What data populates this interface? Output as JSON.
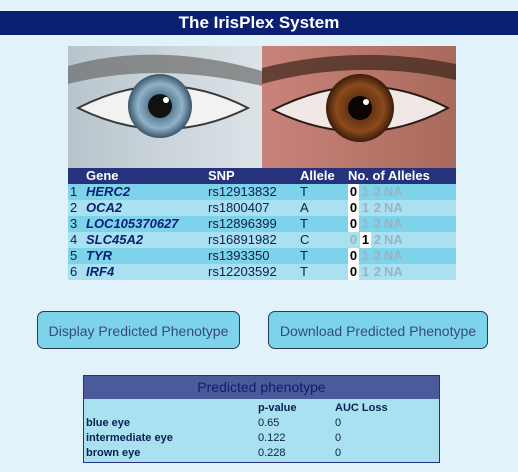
{
  "title": "The IrisPlex System",
  "table": {
    "headers": [
      "Gene",
      "SNP",
      "Allele",
      "No. of Alleles"
    ],
    "allele_options": [
      "0",
      "1",
      "2",
      "NA"
    ],
    "rows": [
      {
        "index": "1",
        "gene": "HERC2",
        "snp": "rs12913832",
        "allele": "T",
        "selected": "0"
      },
      {
        "index": "2",
        "gene": "OCA2",
        "snp": "rs1800407",
        "allele": "A",
        "selected": "0"
      },
      {
        "index": "3",
        "gene": "LOC105370627",
        "snp": "rs12896399",
        "allele": "T",
        "selected": "0"
      },
      {
        "index": "4",
        "gene": "SLC45A2",
        "snp": "rs16891982",
        "allele": "C",
        "selected": "1"
      },
      {
        "index": "5",
        "gene": "TYR",
        "snp": "rs1393350",
        "allele": "T",
        "selected": "0"
      },
      {
        "index": "6",
        "gene": "IRF4",
        "snp": "rs12203592",
        "allele": "T",
        "selected": "0"
      }
    ]
  },
  "buttons": {
    "display": "Display Predicted Phenotype",
    "download": "Download Predicted Phenotype"
  },
  "phenotype": {
    "title": "Predicted phenotype",
    "col_pvalue": "p-value",
    "col_auc": "AUC Loss",
    "rows": [
      {
        "label": "blue eye",
        "pvalue": "0.65",
        "auc": "0"
      },
      {
        "label": "intermediate eye",
        "pvalue": "0.122",
        "auc": "0"
      },
      {
        "label": "brown eye",
        "pvalue": "0.228",
        "auc": "0"
      }
    ]
  },
  "colors": {
    "header_bg": "#0b1f73",
    "page_bg": "#e1f2fb",
    "row_odd": "#7cd3ea",
    "row_even": "#a9e1f1",
    "button_bg": "#7cd3ea"
  }
}
